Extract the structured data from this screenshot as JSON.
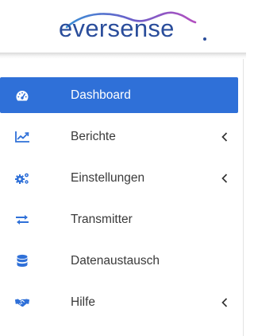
{
  "brand": {
    "logo_text": "eversense",
    "logo_color": "#2a4d9b"
  },
  "colors": {
    "accent": "#2f70d8",
    "active_text": "#ffffff",
    "text": "#3a3a3a"
  },
  "sidebar": {
    "items": [
      {
        "label": "Dashboard",
        "icon": "dashboard-icon",
        "active": true,
        "has_submenu": false
      },
      {
        "label": "Berichte",
        "icon": "chart-icon",
        "active": false,
        "has_submenu": true
      },
      {
        "label": "Einstellungen",
        "icon": "gears-icon",
        "active": false,
        "has_submenu": true
      },
      {
        "label": "Transmitter",
        "icon": "exchange-icon",
        "active": false,
        "has_submenu": false
      },
      {
        "label": "Datenaustausch",
        "icon": "database-icon",
        "active": false,
        "has_submenu": false
      },
      {
        "label": "Hilfe",
        "icon": "handshake-icon",
        "active": false,
        "has_submenu": true
      }
    ]
  }
}
